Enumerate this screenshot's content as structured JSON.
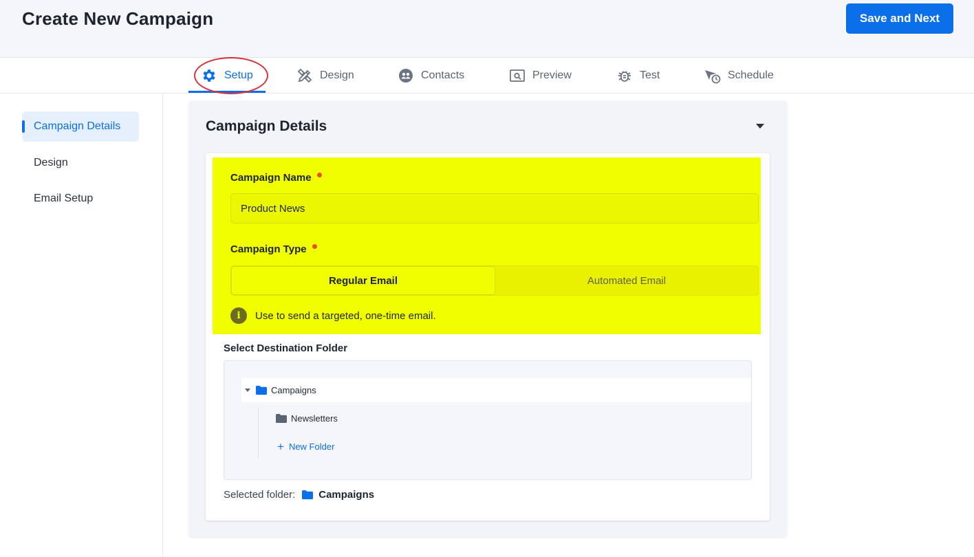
{
  "header": {
    "title": "Create New Campaign",
    "save_label": "Save and Next"
  },
  "tabs": [
    {
      "label": "Setup",
      "icon": "gear-icon",
      "active": true
    },
    {
      "label": "Design",
      "icon": "design-tools-icon"
    },
    {
      "label": "Contacts",
      "icon": "contacts-icon"
    },
    {
      "label": "Preview",
      "icon": "preview-icon"
    },
    {
      "label": "Test",
      "icon": "bug-icon"
    },
    {
      "label": "Schedule",
      "icon": "schedule-icon"
    }
  ],
  "sidebar": {
    "items": [
      {
        "label": "Campaign Details",
        "active": true
      },
      {
        "label": "Design"
      },
      {
        "label": "Email Setup"
      }
    ]
  },
  "panel": {
    "title": "Campaign Details",
    "campaign_name": {
      "label": "Campaign Name",
      "value": "Product News"
    },
    "campaign_type": {
      "label": "Campaign Type",
      "options": [
        "Regular Email",
        "Automated Email"
      ],
      "selected": "Regular Email",
      "info": "Use to send a targeted, one-time email."
    },
    "destination": {
      "label": "Select Destination Folder",
      "root": "Campaigns",
      "children": [
        "Newsletters"
      ],
      "new_folder": "New Folder",
      "selected_label": "Selected folder:",
      "selected_value": "Campaigns"
    }
  },
  "colors": {
    "accent": "#0a6fe8",
    "highlight": "#f1fe00",
    "required": "#e5531a",
    "annotation_circle": "#d8323a"
  }
}
